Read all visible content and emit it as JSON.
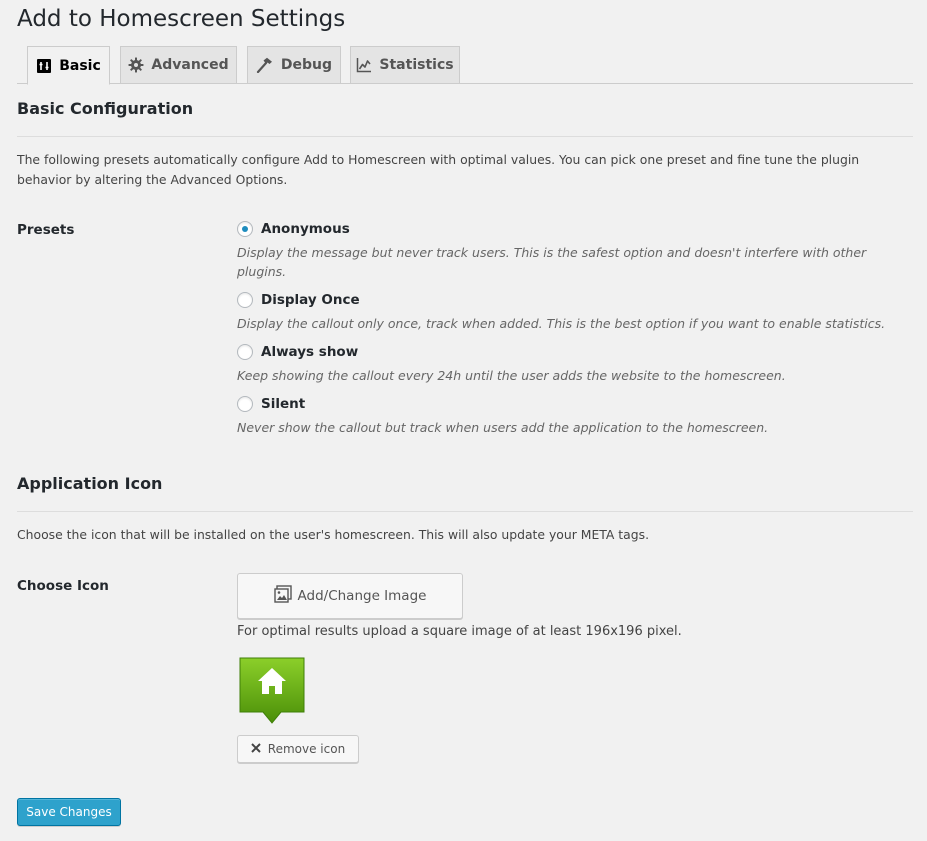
{
  "page": {
    "title": "Add to Homescreen Settings"
  },
  "tabs": [
    {
      "label": "Basic",
      "icon": "basic-icon",
      "active": true
    },
    {
      "label": "Advanced",
      "icon": "gear-icon"
    },
    {
      "label": "Debug",
      "icon": "hammer-icon"
    },
    {
      "label": "Statistics",
      "icon": "chart-line-icon"
    }
  ],
  "basic": {
    "title": "Basic Configuration",
    "description": "The following presets automatically configure Add to Homescreen with optimal values. You can pick one preset and fine tune the plugin behavior by altering the Advanced Options.",
    "presets_label": "Presets",
    "presets": [
      {
        "label": "Anonymous",
        "description": "Display the message but never track users. This is the safest option and doesn't interfere with other plugins.",
        "checked": true
      },
      {
        "label": "Display Once",
        "description": "Display the callout only once, track when added. This is the best option if you want to enable statistics.",
        "checked": false
      },
      {
        "label": "Always show",
        "description": "Keep showing the callout every 24h until the user adds the website to the homescreen.",
        "checked": false
      },
      {
        "label": "Silent",
        "description": "Never show the callout but track when users add the application to the homescreen.",
        "checked": false
      }
    ]
  },
  "icon_section": {
    "title": "Application Icon",
    "description": "Choose the icon that will be installed on the user's homescreen. This will also update your META tags.",
    "choose_label": "Choose Icon",
    "change_button": "Add/Change Image",
    "hint": "For optimal results upload a square image of at least 196x196 pixel.",
    "remove_button": "Remove icon"
  },
  "footer": {
    "save_button": "Save Changes"
  },
  "colors": {
    "accent": "#1e8cbe",
    "primary_button": "#2ea2cc",
    "icon_green": "#5da40e"
  }
}
